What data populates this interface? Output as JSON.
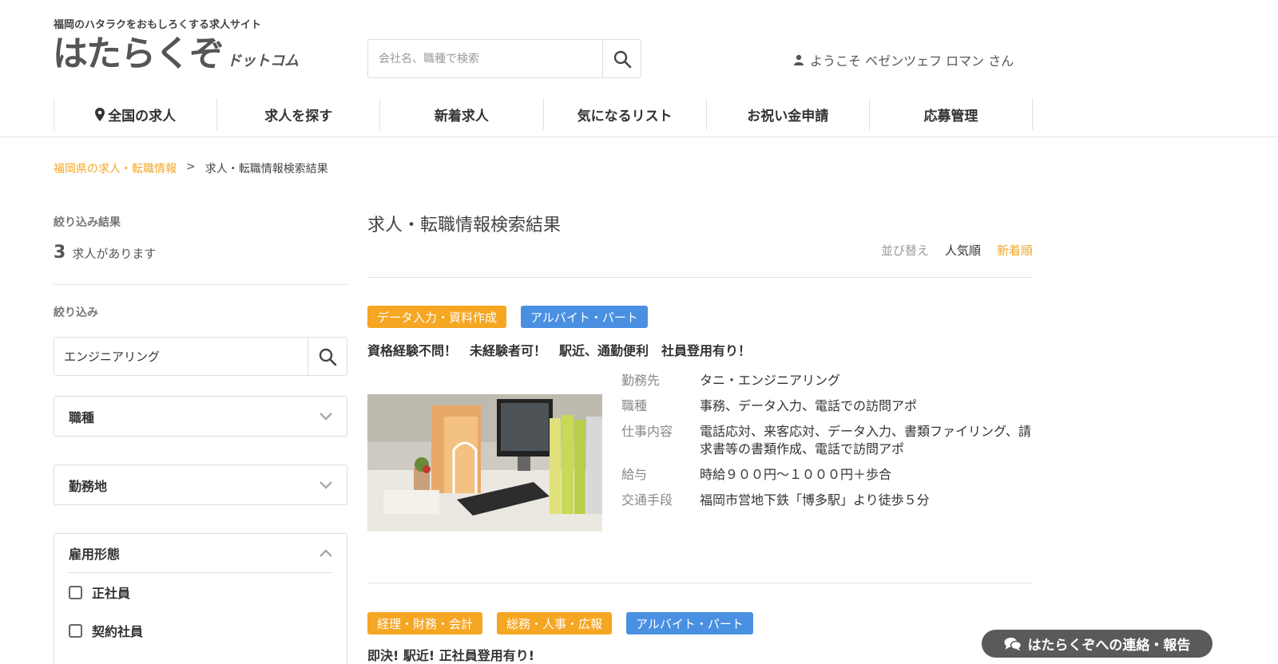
{
  "header": {
    "tagline": "福岡のハタラクをおもしろくする求人サイト",
    "logo_main": "はたらくぞ",
    "logo_sub": "ドットコム",
    "search_placeholder": "会社名、職種で検索",
    "welcome": "ようこそ ベゼンツェフ ロマン さん"
  },
  "nav": [
    {
      "label": "全国の求人",
      "icon": "map-pin-icon"
    },
    {
      "label": "求人を探す"
    },
    {
      "label": "新着求人"
    },
    {
      "label": "気になるリスト"
    },
    {
      "label": "お祝い金申請"
    },
    {
      "label": "応募管理"
    }
  ],
  "breadcrumb": {
    "link": "福岡県の求人・転職情報",
    "separator": ">",
    "current": "求人・転職情報検索結果"
  },
  "sidebar": {
    "results_heading": "絞り込み結果",
    "count": "3",
    "count_text": "求人があります",
    "filter_heading": "絞り込み",
    "filter_value": "エンジニアリング",
    "accordions": [
      {
        "label": "職種"
      },
      {
        "label": "勤務地"
      },
      {
        "label": "雇用形態",
        "options": [
          "正社員",
          "契約社員"
        ]
      }
    ]
  },
  "main": {
    "title": "求人・転職情報検索結果",
    "sort_label": "並び替え",
    "sort_popular": "人気順",
    "sort_new": "新着順",
    "jobs": [
      {
        "tags": [
          {
            "label": "データ入力・資料作成",
            "color": "#f5a623"
          },
          {
            "label": "アルバイト・パート",
            "color": "#4a90e2"
          }
        ],
        "title": "資格経験不問！　未経験者可！　駅近、通勤便利　社員登用有り！",
        "details": [
          {
            "label": "勤務先",
            "value": "タニ・エンジニアリング"
          },
          {
            "label": "職種",
            "value": "事務、データ入力、電話での訪問アポ"
          },
          {
            "label": "仕事内容",
            "value": "電話応対、来客応対、データ入力、書類ファイリング、請求書等の書類作成、電話で訪問アポ"
          },
          {
            "label": "給与",
            "value": "時給９００円～１０００円＋歩合"
          },
          {
            "label": "交通手段",
            "value": "福岡市営地下鉄「博多駅」より徒歩５分"
          }
        ]
      },
      {
        "tags": [
          {
            "label": "経理・財務・会計",
            "color": "#f5a623"
          },
          {
            "label": "総務・人事・広報",
            "color": "#f5a623"
          },
          {
            "label": "アルバイト・パート",
            "color": "#4a90e2"
          }
        ],
        "title": "即決! 駅近! 正社員登用有り!"
      }
    ]
  },
  "contact_button": "はたらくぞへの連絡・報告",
  "colors": {
    "accent": "#f5a623",
    "tag_blue": "#4a90e2",
    "contact_bg": "#5a5a5a"
  }
}
